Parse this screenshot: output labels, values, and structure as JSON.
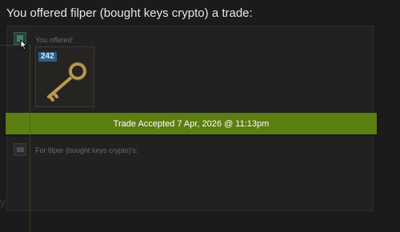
{
  "heading": "You offered filper (bought keys crypto) a trade:",
  "offer": {
    "label": "You offered:",
    "item": {
      "count": "242",
      "icon": "key-icon"
    }
  },
  "status": {
    "text": "Trade Accepted 7 Apr, 2026 @ 11:13pm",
    "color": "#5b7f11"
  },
  "receive": {
    "label": "For filper (bought keys crypto)'s:"
  },
  "ghost_char": "y"
}
